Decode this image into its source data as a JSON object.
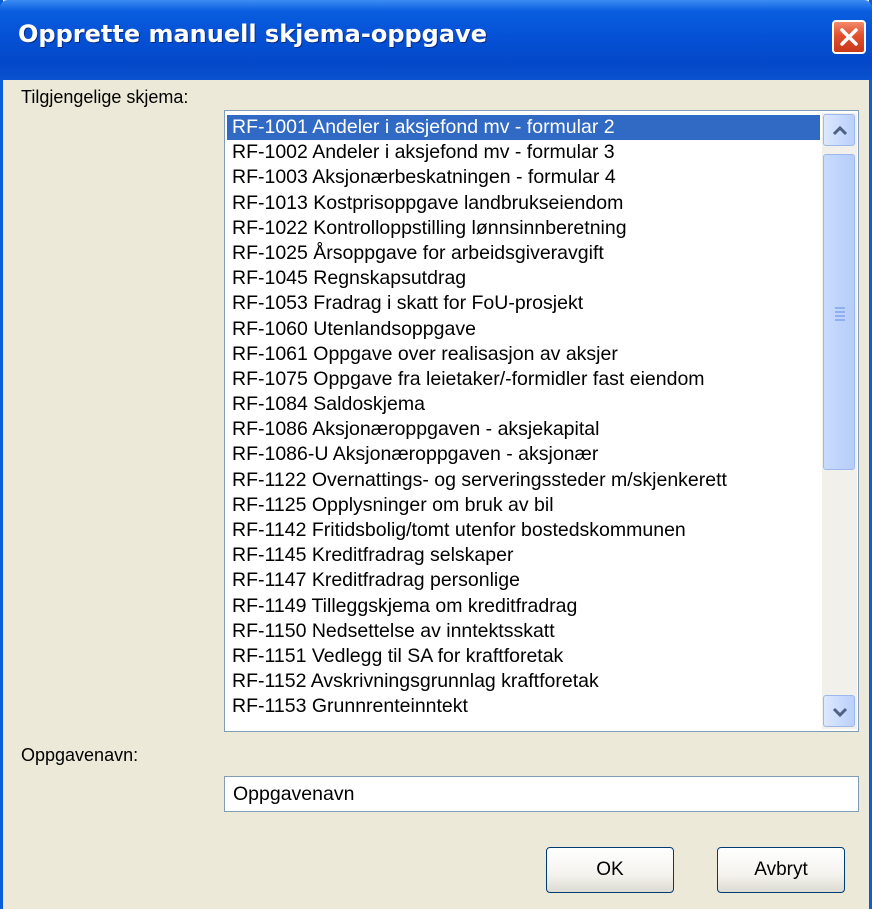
{
  "window": {
    "title": "Opprette manuell skjema-oppgave"
  },
  "list_label": "Tilgjengelige skjema:",
  "list": {
    "selected_index": 0,
    "items": [
      "RF-1001 Andeler i aksjefond mv - formular 2",
      "RF-1002 Andeler i aksjefond mv - formular 3",
      "RF-1003 Aksjonærbeskatningen - formular 4",
      "RF-1013 Kostprisoppgave landbrukseiendom",
      "RF-1022 Kontrolloppstilling lønnsinnberetning",
      "RF-1025 Årsoppgave for arbeidsgiveravgift",
      "RF-1045 Regnskapsutdrag",
      "RF-1053 Fradrag i skatt for FoU-prosjekt",
      "RF-1060 Utenlandsoppgave",
      "RF-1061 Oppgave over realisasjon av aksjer",
      "RF-1075 Oppgave fra leietaker/-formidler fast eiendom",
      "RF-1084 Saldoskjema",
      "RF-1086 Aksjonæroppgaven - aksjekapital",
      "RF-1086-U Aksjonæroppgaven - aksjonær",
      "RF-1122 Overnattings- og serveringssteder m/skjenkerett",
      "RF-1125 Opplysninger om bruk av bil",
      "RF-1142 Fritidsbolig/tomt utenfor bostedskommunen",
      "RF-1145 Kreditfradrag selskaper",
      "RF-1147 Kreditfradrag personlige",
      "RF-1149 Tilleggskjema om kreditfradrag",
      "RF-1150 Nedsettelse av inntektsskatt",
      "RF-1151 Vedlegg til SA for kraftforetak",
      "RF-1152 Avskrivningsgrunnlag kraftforetak",
      "RF-1153 Grunnrenteinntekt"
    ]
  },
  "name_label": "Oppgavenavn:",
  "name_field": {
    "value": "Oppgavenavn"
  },
  "buttons": {
    "ok": "OK",
    "cancel": "Avbryt"
  },
  "icons": {
    "close": "close-icon",
    "scroll_up": "chevron-up-icon",
    "scroll_down": "chevron-down-icon"
  },
  "colors": {
    "titlebar": "#0551d6",
    "selection": "#316ac5",
    "close_button": "#e1502e",
    "dialog_bg": "#ece9d8"
  }
}
